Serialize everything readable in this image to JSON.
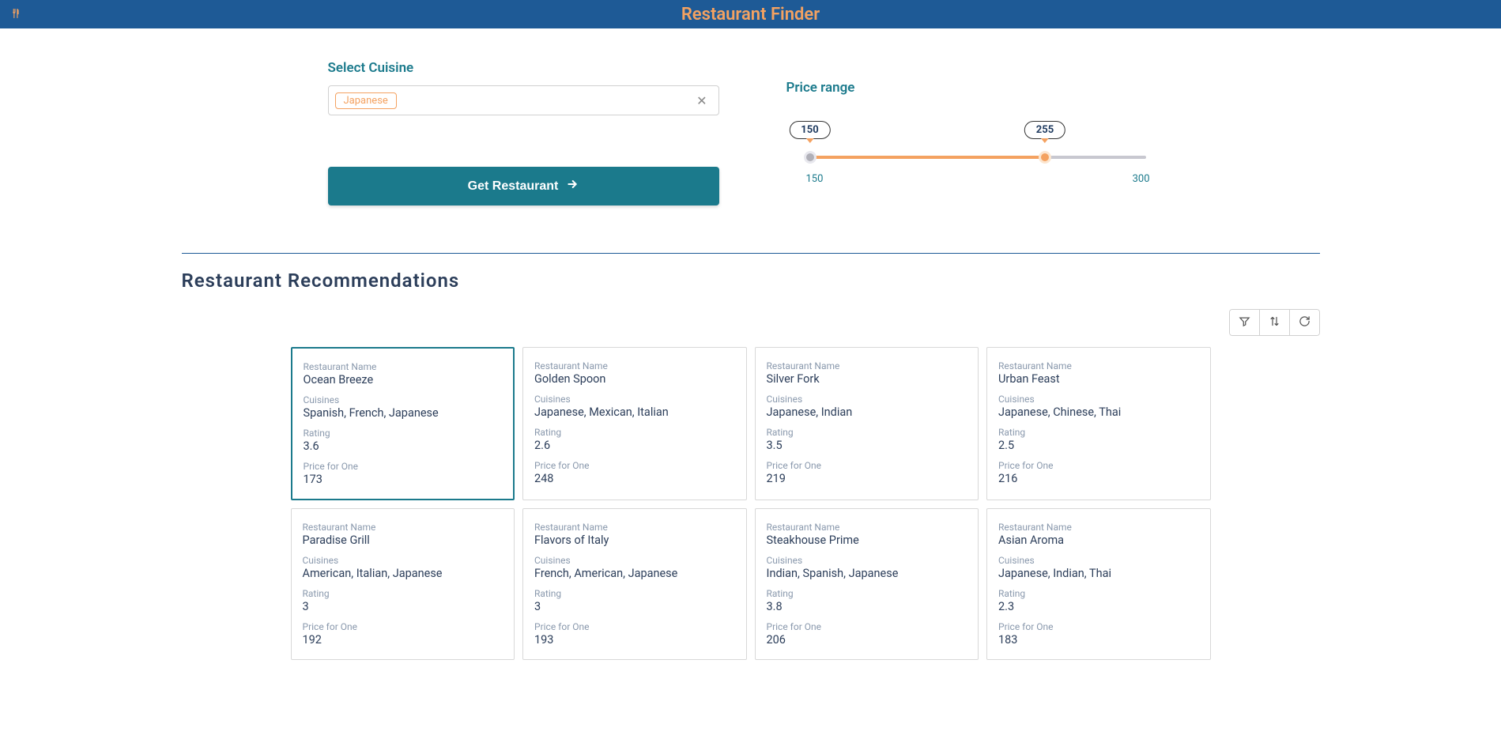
{
  "header": {
    "title": "Restaurant Finder"
  },
  "filters": {
    "cuisine_label": "Select Cuisine",
    "cuisine_chip": "Japanese",
    "price_label": "Price range",
    "price_min": "150",
    "price_max": "255",
    "scale_min": "150",
    "scale_max": "300",
    "button_label": "Get Restaurant"
  },
  "section_title": "Restaurant Recommendations",
  "field_labels": {
    "name": "Restaurant Name",
    "cuisines": "Cuisines",
    "rating": "Rating",
    "price": "Price for One"
  },
  "restaurants": [
    {
      "name": "Ocean Breeze",
      "cuisines": "Spanish, French, Japanese",
      "rating": "3.6",
      "price": "173",
      "selected": true
    },
    {
      "name": "Golden Spoon",
      "cuisines": "Japanese, Mexican, Italian",
      "rating": "2.6",
      "price": "248",
      "selected": false
    },
    {
      "name": "Silver Fork",
      "cuisines": "Japanese, Indian",
      "rating": "3.5",
      "price": "219",
      "selected": false
    },
    {
      "name": "Urban Feast",
      "cuisines": "Japanese, Chinese, Thai",
      "rating": "2.5",
      "price": "216",
      "selected": false
    },
    {
      "name": "Paradise Grill",
      "cuisines": "American, Italian, Japanese",
      "rating": "3",
      "price": "192",
      "selected": false
    },
    {
      "name": "Flavors of Italy",
      "cuisines": "French, American, Japanese",
      "rating": "3",
      "price": "193",
      "selected": false
    },
    {
      "name": "Steakhouse Prime",
      "cuisines": "Indian, Spanish, Japanese",
      "rating": "3.8",
      "price": "206",
      "selected": false
    },
    {
      "name": "Asian Aroma",
      "cuisines": "Japanese, Indian, Thai",
      "rating": "2.3",
      "price": "183",
      "selected": false
    }
  ]
}
